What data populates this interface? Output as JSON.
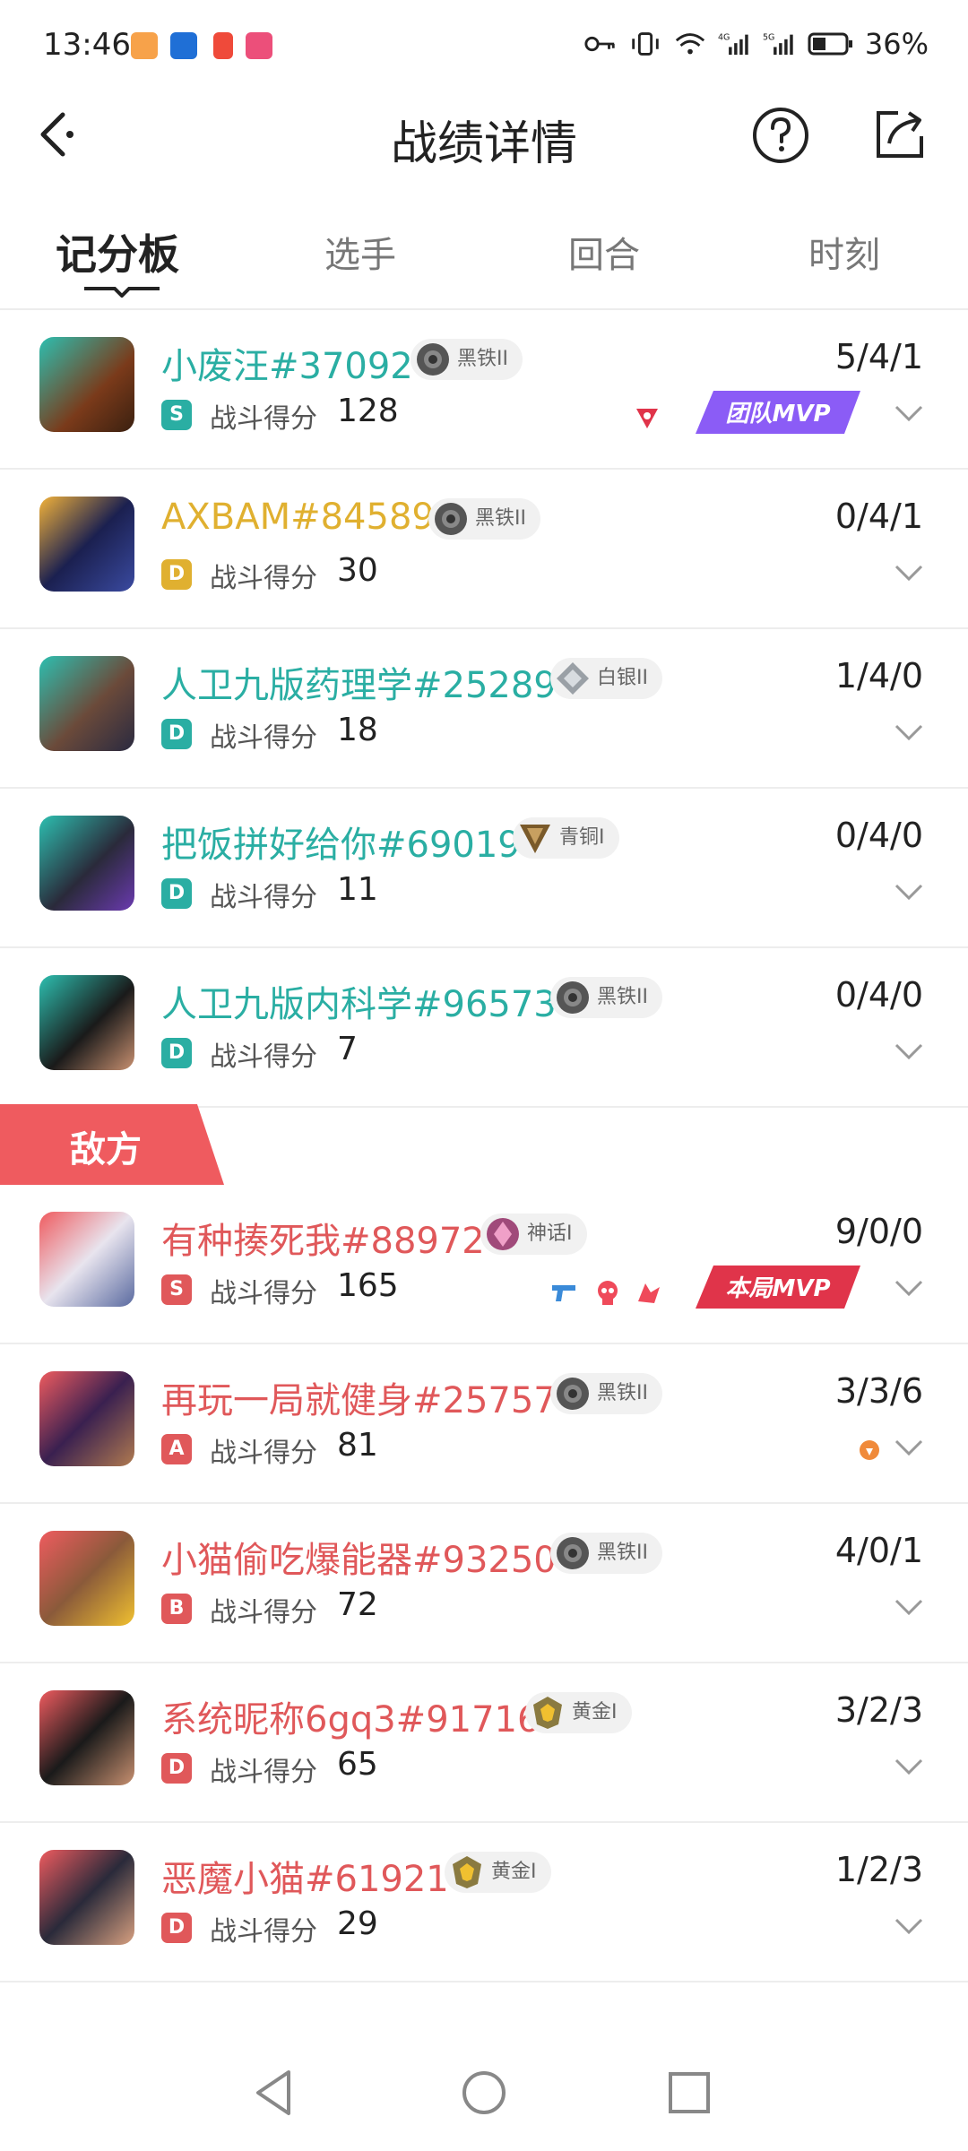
{
  "status_bar": {
    "time": "13:46",
    "battery": "36%",
    "net1": "4G",
    "net2": "5G"
  },
  "header": {
    "title": "战绩详情"
  },
  "tabs": [
    "记分板",
    "选手",
    "回合",
    "时刻"
  ],
  "score_label": "战斗得分",
  "ally": [
    {
      "name": "小废汪#37092",
      "rank": "黑铁II",
      "grade": "S",
      "score": "128",
      "kda": "5/4/1",
      "mvp": "团队MVP"
    },
    {
      "name": "AXBAM#84589",
      "rank": "黑铁II",
      "grade": "D",
      "score": "30",
      "kda": "0/4/1"
    },
    {
      "name": "人卫九版药理学#25289",
      "rank": "白银II",
      "grade": "D",
      "score": "18",
      "kda": "1/4/0"
    },
    {
      "name": "把饭拼好给你#69019",
      "rank": "青铜I",
      "grade": "D",
      "score": "11",
      "kda": "0/4/0"
    },
    {
      "name": "人卫九版内科学#96573",
      "rank": "黑铁II",
      "grade": "D",
      "score": "7",
      "kda": "0/4/0"
    }
  ],
  "enemy_label": "敌方",
  "enemy": [
    {
      "name": "有种揍死我#88972",
      "rank": "神话I",
      "grade": "S",
      "score": "165",
      "kda": "9/0/0",
      "mvp": "本局MVP"
    },
    {
      "name": "再玩一局就健身#25757",
      "rank": "黑铁II",
      "grade": "A",
      "score": "81",
      "kda": "3/3/6"
    },
    {
      "name": "小猫偷吃爆能器#93250",
      "rank": "黑铁II",
      "grade": "B",
      "score": "72",
      "kda": "4/0/1"
    },
    {
      "name": "系统昵称6gq3#91716",
      "rank": "黄金I",
      "grade": "D",
      "score": "65",
      "kda": "3/2/3"
    },
    {
      "name": "恶魔小猫#61921",
      "rank": "黄金I",
      "grade": "D",
      "score": "29",
      "kda": "1/2/3"
    }
  ],
  "colors": {
    "ally_name": "#2aaea3",
    "ally_name_alt": "#e0b030",
    "enemy_name": "#e0585a",
    "enemy_banner": "#ef5b5f",
    "team_mvp": "#8b5cf6",
    "match_mvp": "#e0344a"
  }
}
